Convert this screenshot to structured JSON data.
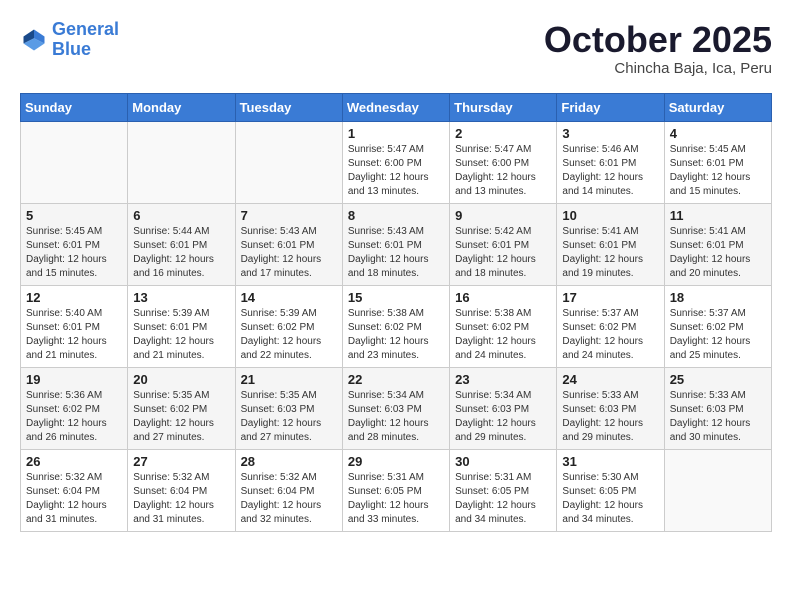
{
  "logo": {
    "line1": "General",
    "line2": "Blue"
  },
  "title": "October 2025",
  "subtitle": "Chincha Baja, Ica, Peru",
  "weekdays": [
    "Sunday",
    "Monday",
    "Tuesday",
    "Wednesday",
    "Thursday",
    "Friday",
    "Saturday"
  ],
  "weeks": [
    [
      {
        "day": "",
        "info": ""
      },
      {
        "day": "",
        "info": ""
      },
      {
        "day": "",
        "info": ""
      },
      {
        "day": "1",
        "info": "Sunrise: 5:47 AM\nSunset: 6:00 PM\nDaylight: 12 hours\nand 13 minutes."
      },
      {
        "day": "2",
        "info": "Sunrise: 5:47 AM\nSunset: 6:00 PM\nDaylight: 12 hours\nand 13 minutes."
      },
      {
        "day": "3",
        "info": "Sunrise: 5:46 AM\nSunset: 6:01 PM\nDaylight: 12 hours\nand 14 minutes."
      },
      {
        "day": "4",
        "info": "Sunrise: 5:45 AM\nSunset: 6:01 PM\nDaylight: 12 hours\nand 15 minutes."
      }
    ],
    [
      {
        "day": "5",
        "info": "Sunrise: 5:45 AM\nSunset: 6:01 PM\nDaylight: 12 hours\nand 15 minutes."
      },
      {
        "day": "6",
        "info": "Sunrise: 5:44 AM\nSunset: 6:01 PM\nDaylight: 12 hours\nand 16 minutes."
      },
      {
        "day": "7",
        "info": "Sunrise: 5:43 AM\nSunset: 6:01 PM\nDaylight: 12 hours\nand 17 minutes."
      },
      {
        "day": "8",
        "info": "Sunrise: 5:43 AM\nSunset: 6:01 PM\nDaylight: 12 hours\nand 18 minutes."
      },
      {
        "day": "9",
        "info": "Sunrise: 5:42 AM\nSunset: 6:01 PM\nDaylight: 12 hours\nand 18 minutes."
      },
      {
        "day": "10",
        "info": "Sunrise: 5:41 AM\nSunset: 6:01 PM\nDaylight: 12 hours\nand 19 minutes."
      },
      {
        "day": "11",
        "info": "Sunrise: 5:41 AM\nSunset: 6:01 PM\nDaylight: 12 hours\nand 20 minutes."
      }
    ],
    [
      {
        "day": "12",
        "info": "Sunrise: 5:40 AM\nSunset: 6:01 PM\nDaylight: 12 hours\nand 21 minutes."
      },
      {
        "day": "13",
        "info": "Sunrise: 5:39 AM\nSunset: 6:01 PM\nDaylight: 12 hours\nand 21 minutes."
      },
      {
        "day": "14",
        "info": "Sunrise: 5:39 AM\nSunset: 6:02 PM\nDaylight: 12 hours\nand 22 minutes."
      },
      {
        "day": "15",
        "info": "Sunrise: 5:38 AM\nSunset: 6:02 PM\nDaylight: 12 hours\nand 23 minutes."
      },
      {
        "day": "16",
        "info": "Sunrise: 5:38 AM\nSunset: 6:02 PM\nDaylight: 12 hours\nand 24 minutes."
      },
      {
        "day": "17",
        "info": "Sunrise: 5:37 AM\nSunset: 6:02 PM\nDaylight: 12 hours\nand 24 minutes."
      },
      {
        "day": "18",
        "info": "Sunrise: 5:37 AM\nSunset: 6:02 PM\nDaylight: 12 hours\nand 25 minutes."
      }
    ],
    [
      {
        "day": "19",
        "info": "Sunrise: 5:36 AM\nSunset: 6:02 PM\nDaylight: 12 hours\nand 26 minutes."
      },
      {
        "day": "20",
        "info": "Sunrise: 5:35 AM\nSunset: 6:02 PM\nDaylight: 12 hours\nand 27 minutes."
      },
      {
        "day": "21",
        "info": "Sunrise: 5:35 AM\nSunset: 6:03 PM\nDaylight: 12 hours\nand 27 minutes."
      },
      {
        "day": "22",
        "info": "Sunrise: 5:34 AM\nSunset: 6:03 PM\nDaylight: 12 hours\nand 28 minutes."
      },
      {
        "day": "23",
        "info": "Sunrise: 5:34 AM\nSunset: 6:03 PM\nDaylight: 12 hours\nand 29 minutes."
      },
      {
        "day": "24",
        "info": "Sunrise: 5:33 AM\nSunset: 6:03 PM\nDaylight: 12 hours\nand 29 minutes."
      },
      {
        "day": "25",
        "info": "Sunrise: 5:33 AM\nSunset: 6:03 PM\nDaylight: 12 hours\nand 30 minutes."
      }
    ],
    [
      {
        "day": "26",
        "info": "Sunrise: 5:32 AM\nSunset: 6:04 PM\nDaylight: 12 hours\nand 31 minutes."
      },
      {
        "day": "27",
        "info": "Sunrise: 5:32 AM\nSunset: 6:04 PM\nDaylight: 12 hours\nand 31 minutes."
      },
      {
        "day": "28",
        "info": "Sunrise: 5:32 AM\nSunset: 6:04 PM\nDaylight: 12 hours\nand 32 minutes."
      },
      {
        "day": "29",
        "info": "Sunrise: 5:31 AM\nSunset: 6:05 PM\nDaylight: 12 hours\nand 33 minutes."
      },
      {
        "day": "30",
        "info": "Sunrise: 5:31 AM\nSunset: 6:05 PM\nDaylight: 12 hours\nand 34 minutes."
      },
      {
        "day": "31",
        "info": "Sunrise: 5:30 AM\nSunset: 6:05 PM\nDaylight: 12 hours\nand 34 minutes."
      },
      {
        "day": "",
        "info": ""
      }
    ]
  ]
}
